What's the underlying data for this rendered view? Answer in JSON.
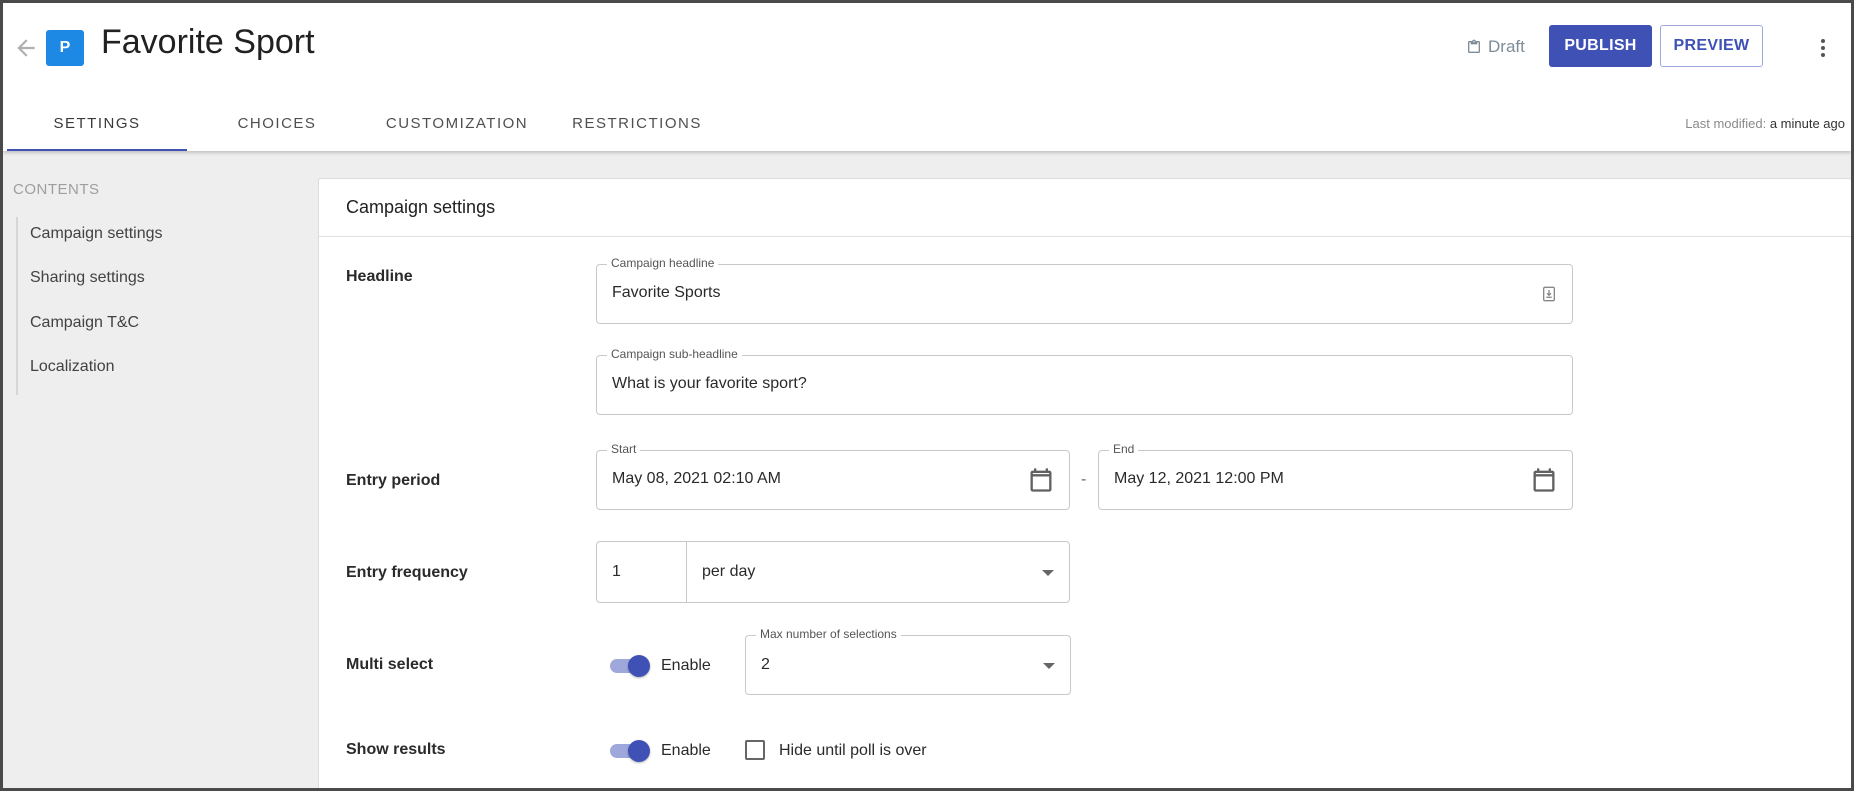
{
  "header": {
    "badge_letter": "P",
    "title": "Favorite Sport",
    "status": "Draft",
    "publish_label": "PUBLISH",
    "preview_label": "PREVIEW",
    "last_modified_label": "Last modified:",
    "last_modified_value": "a minute ago"
  },
  "tabs": [
    {
      "label": "SETTINGS",
      "active": true
    },
    {
      "label": "CHOICES",
      "active": false
    },
    {
      "label": "CUSTOMIZATION",
      "active": false
    },
    {
      "label": "RESTRICTIONS",
      "active": false
    }
  ],
  "sidebar": {
    "heading": "CONTENTS",
    "items": [
      {
        "label": "Campaign settings"
      },
      {
        "label": "Sharing settings"
      },
      {
        "label": "Campaign T&C"
      },
      {
        "label": "Localization"
      }
    ]
  },
  "card": {
    "title": "Campaign settings",
    "headline": {
      "label": "Headline",
      "campaign_headline_label": "Campaign headline",
      "campaign_headline_value": "Favorite Sports",
      "sub_headline_label": "Campaign sub-headline",
      "sub_headline_value": "What is your favorite sport?"
    },
    "entry_period": {
      "label": "Entry period",
      "start_label": "Start",
      "start_value": "May 08, 2021 02:10 AM",
      "separator": "-",
      "end_label": "End",
      "end_value": "May 12, 2021 12:00 PM"
    },
    "entry_frequency": {
      "label": "Entry frequency",
      "count": "1",
      "period": "per day"
    },
    "multi_select": {
      "label": "Multi select",
      "toggle_label": "Enable",
      "enabled": true,
      "max_label": "Max number of selections",
      "max_value": "2"
    },
    "show_results": {
      "label": "Show results",
      "toggle_label": "Enable",
      "enabled": true,
      "hide_label": "Hide until poll is over",
      "hide_checked": false
    }
  },
  "colors": {
    "accent": "#3f51b5",
    "badge": "#1e88e5",
    "toggle_track": "#9fa8da"
  }
}
